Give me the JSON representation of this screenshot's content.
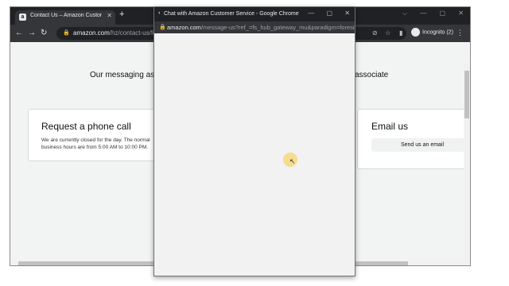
{
  "main_window": {
    "tab_title": "Contact Us – Amazon Customer S",
    "tab_favicon": "a",
    "newtab_glyph": "+",
    "window_controls": [
      "⌵",
      "—",
      "▢",
      "✕"
    ],
    "url_host": "amazon.com",
    "url_path": "/hz/contact-us/foresig",
    "profile_label": "Incognito (2)",
    "content": {
      "messaging_left": "Our messaging assis",
      "messaging_right": "associate",
      "phone_card": {
        "title": "Request a phone call",
        "body": "We are currently closed for the day. The normal business hours are from 5:00 AM to 10:00 PM."
      },
      "email_card": {
        "title": "Email us",
        "button": "Send us an email"
      }
    }
  },
  "popup": {
    "title": "Chat with Amazon Customer Service - Google Chrome",
    "url_host": "amazon.com",
    "url_path": "/message-us?ref_=fs_hub_gateway_mu&paradigm=foresig...",
    "controls": [
      "—",
      "▢",
      "✕"
    ]
  },
  "icons": {
    "back": "←",
    "forward": "→",
    "reload": "↻",
    "lock": "🔒",
    "eye_off": "⊘",
    "star": "☆",
    "sidebar": "▮",
    "menu": "⋮",
    "close": "✕",
    "cursor": "↖"
  }
}
